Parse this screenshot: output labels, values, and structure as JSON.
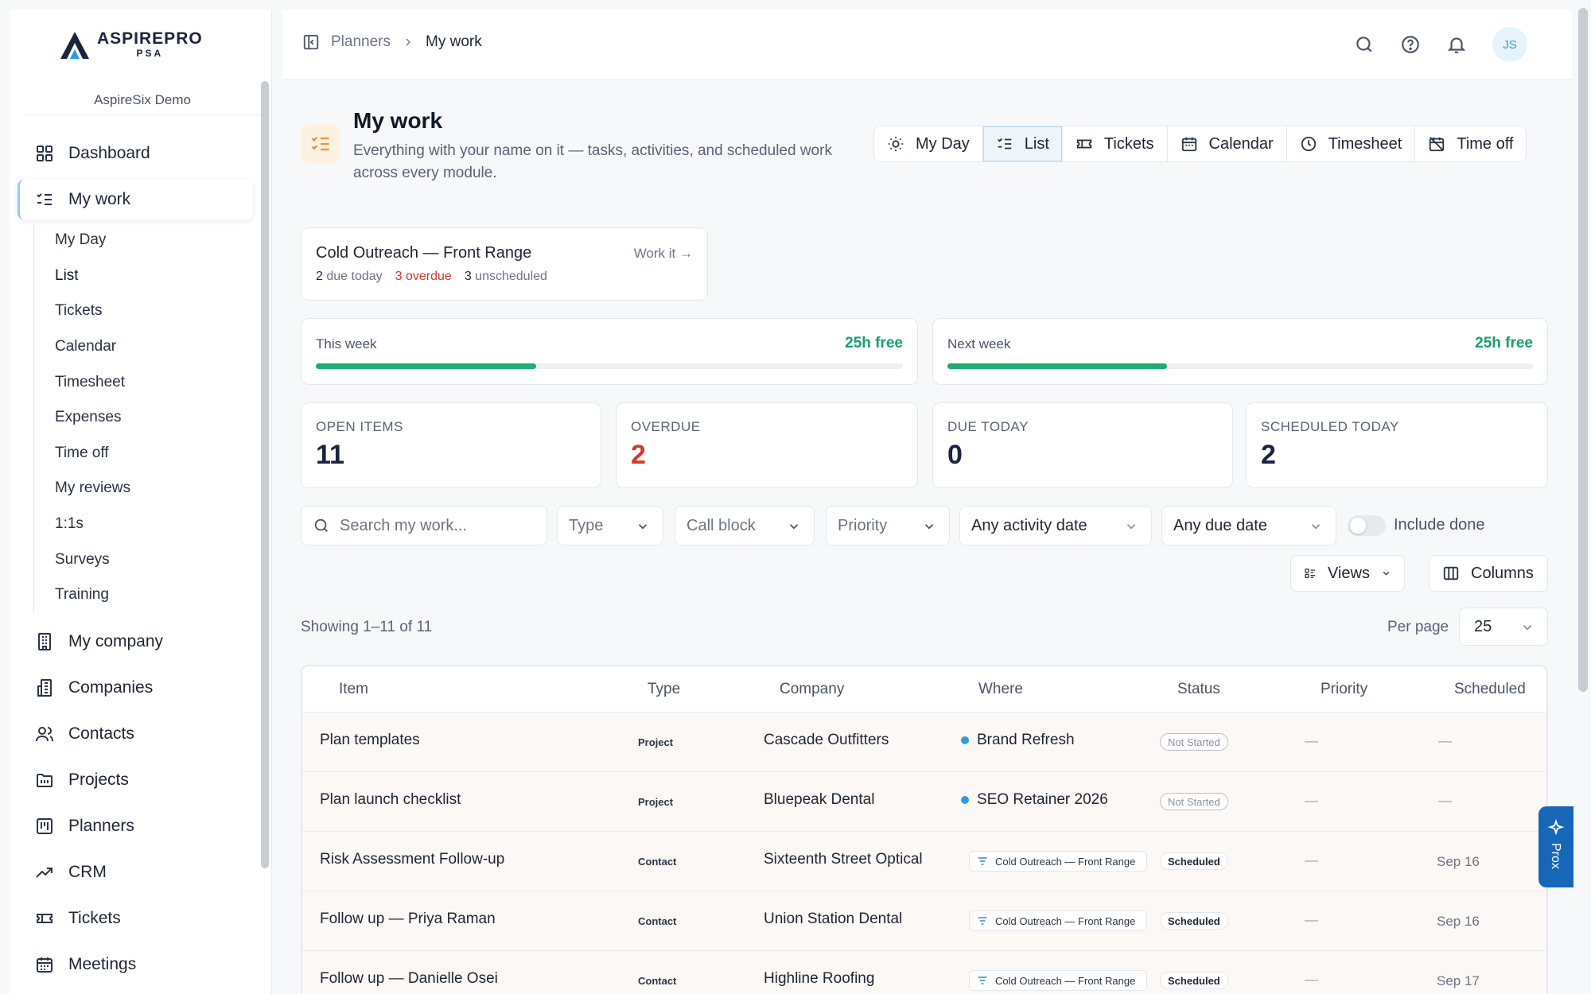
{
  "brand": {
    "name": "ASPIREPRO",
    "sub": "PSA",
    "org": "AspireSix Demo"
  },
  "sidebar": {
    "nav_top": [
      {
        "label": "Dashboard",
        "icon": "grid-icon"
      },
      {
        "label": "My work",
        "icon": "checklist-icon"
      }
    ],
    "sub_items": [
      "My Day",
      "List",
      "Tickets",
      "Calendar",
      "Timesheet",
      "Expenses",
      "Time off",
      "My reviews",
      "1:1s",
      "Surveys",
      "Training"
    ],
    "nav_bottom": [
      {
        "label": "My company",
        "icon": "building-icon"
      },
      {
        "label": "Companies",
        "icon": "buildings-icon"
      },
      {
        "label": "Contacts",
        "icon": "users-icon"
      },
      {
        "label": "Projects",
        "icon": "folder-icon"
      },
      {
        "label": "Planners",
        "icon": "kanban-icon"
      },
      {
        "label": "CRM",
        "icon": "trend-icon"
      },
      {
        "label": "Tickets",
        "icon": "ticket-icon"
      },
      {
        "label": "Meetings",
        "icon": "calendar-icon"
      }
    ]
  },
  "breadcrumb": {
    "parent": "Planners",
    "current": "My work"
  },
  "user": {
    "initials": "JS"
  },
  "header": {
    "title": "My work",
    "subtitle": "Everything with your name on it — tasks, activities, and scheduled work across every module."
  },
  "view_tabs": [
    {
      "label": "My Day",
      "icon": "sun-icon"
    },
    {
      "label": "List",
      "icon": "list-icon"
    },
    {
      "label": "Tickets",
      "icon": "ticket-icon"
    },
    {
      "label": "Calendar",
      "icon": "calendar-icon"
    },
    {
      "label": "Timesheet",
      "icon": "clock-icon"
    },
    {
      "label": "Time off",
      "icon": "calendar-off-icon"
    }
  ],
  "focus_card": {
    "title": "Cold Outreach — Front Range",
    "link": "Work it →",
    "due_today_n": "2",
    "due_today_label": "due today",
    "overdue": "3 overdue",
    "unscheduled_n": "3",
    "unscheduled_label": "unscheduled"
  },
  "capacity": [
    {
      "label": "This week",
      "free": "25h free",
      "fill_fraction": 0.375
    },
    {
      "label": "Next week",
      "free": "25h free",
      "fill_fraction": 0.375
    }
  ],
  "stats": [
    {
      "label": "OPEN ITEMS",
      "value": "11"
    },
    {
      "label": "OVERDUE",
      "value": "2"
    },
    {
      "label": "DUE TODAY",
      "value": "0"
    },
    {
      "label": "SCHEDULED TODAY",
      "value": "2"
    }
  ],
  "filters": {
    "search_placeholder": "Search my work...",
    "type": "Type",
    "call_block": "Call block",
    "priority": "Priority",
    "activity_date": "Any activity date",
    "due_date": "Any due date",
    "include_done": "Include done",
    "include_done_on": false
  },
  "table_controls": {
    "views": "Views",
    "columns": "Columns",
    "showing": "Showing 1–11 of 11",
    "per_page_label": "Per page",
    "per_page": "25"
  },
  "table": {
    "columns": [
      "Item",
      "Type",
      "Company",
      "Where",
      "Status",
      "Priority",
      "Scheduled"
    ],
    "rows": [
      {
        "item": "Plan templates",
        "type": "Project",
        "company": "Cascade Outfitters",
        "where": "Brand Refresh",
        "where_kind": "project",
        "status": "Not Started",
        "priority": "—",
        "scheduled": "—"
      },
      {
        "item": "Plan launch checklist",
        "type": "Project",
        "company": "Bluepeak Dental",
        "where": "SEO Retainer 2026",
        "where_kind": "project",
        "status": "Not Started",
        "priority": "—",
        "scheduled": "—"
      },
      {
        "item": "Risk Assessment Follow-up",
        "type": "Contact",
        "company": "Sixteenth Street Optical",
        "where": "Cold Outreach — Front Range",
        "where_kind": "callblock",
        "status": "Scheduled",
        "priority": "—",
        "scheduled": "Sep 16"
      },
      {
        "item": "Follow up — Priya Raman",
        "type": "Contact",
        "company": "Union Station Dental",
        "where": "Cold Outreach — Front Range",
        "where_kind": "callblock",
        "status": "Scheduled",
        "priority": "—",
        "scheduled": "Sep 16"
      },
      {
        "item": "Follow up — Danielle Osei",
        "type": "Contact",
        "company": "Highline Roofing",
        "where": "Cold Outreach — Front Range",
        "where_kind": "callblock",
        "status": "Scheduled",
        "priority": "—",
        "scheduled": "Sep 17"
      }
    ]
  },
  "prox": {
    "label": "Prox"
  },
  "colors": {
    "accent": "#1767b8",
    "success": "#1fab72",
    "danger": "#d23a2e",
    "warning_bg": "#fdf1e2"
  }
}
